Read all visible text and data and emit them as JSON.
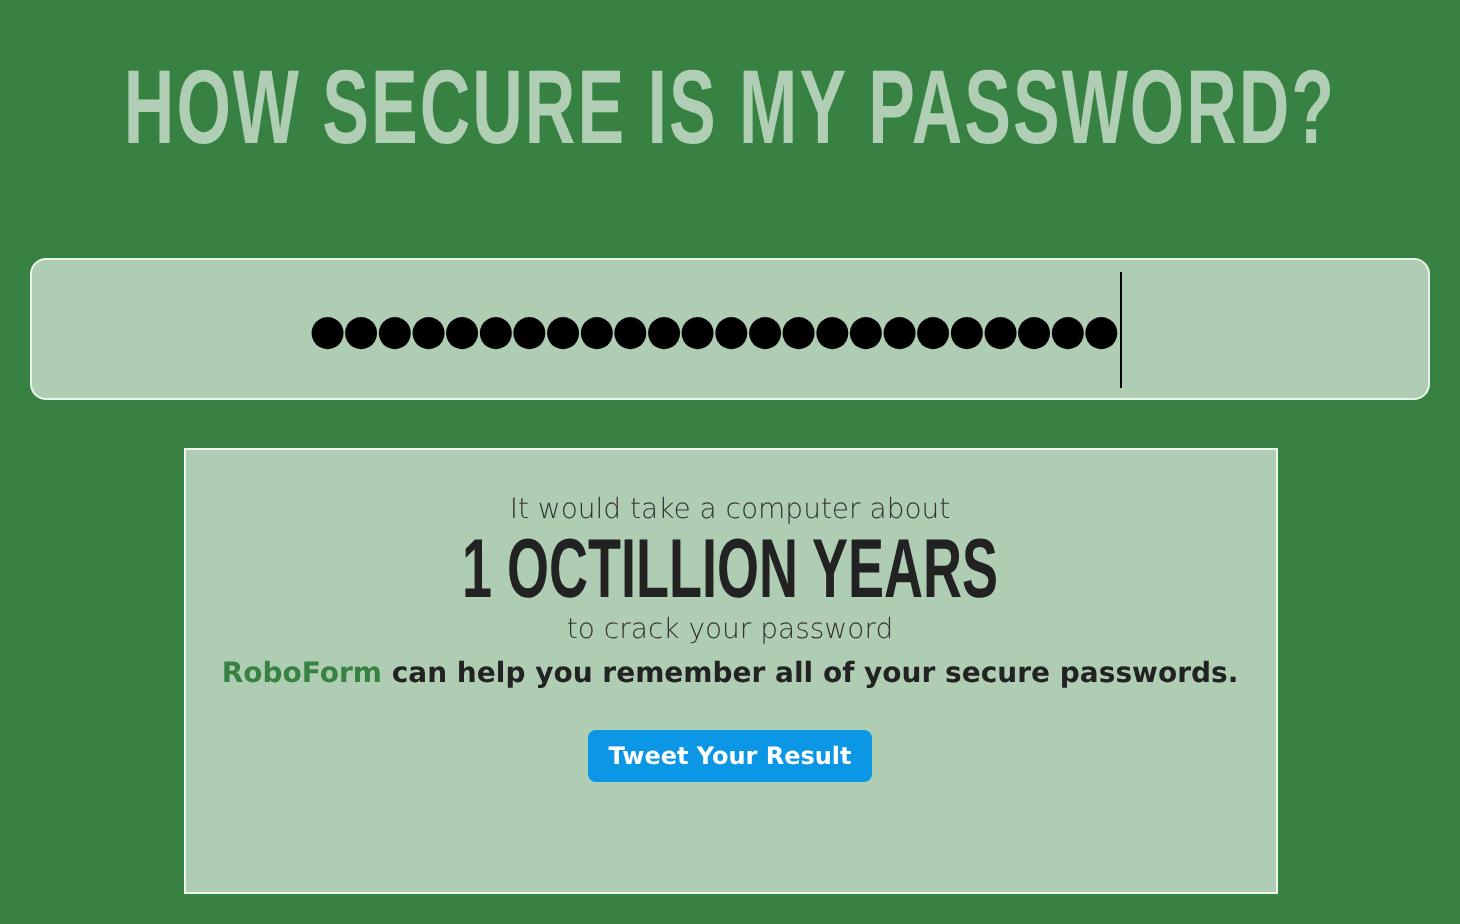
{
  "title": "HOW SECURE IS MY PASSWORD?",
  "password_field": {
    "value": "●●●●●●●●●●●●●●●●●●●●●●●●"
  },
  "result": {
    "intro": "It would take a computer about",
    "time": "1 OCTILLION YEARS",
    "outro": "to crack your password",
    "promo_link": "RoboForm",
    "promo_text": "can help you remember all of your secure passwords.",
    "button": "Tweet Your Result"
  }
}
